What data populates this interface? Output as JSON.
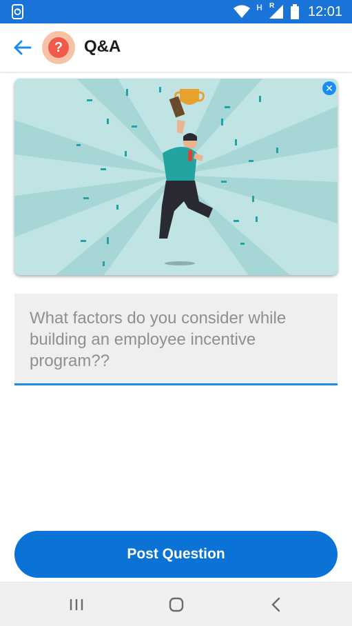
{
  "status_bar": {
    "time": "12:01",
    "network_label": "H",
    "roaming_label": "R",
    "icons": [
      "sync-phone-icon",
      "wifi-icon",
      "signal-icon",
      "battery-icon"
    ]
  },
  "app_bar": {
    "title": "Q&A",
    "avatar_glyph": "?",
    "back_icon": "arrow-left-icon",
    "accent_color": "#1a8cf0"
  },
  "banner": {
    "illustration": "celebrating-man-with-trophy",
    "close_icon": "close-icon"
  },
  "question": {
    "text": "What factors do you consider while building an employee incentive program??"
  },
  "post_button": {
    "label": "Post Question",
    "color": "#0b72d6"
  },
  "nav_bar": {
    "icons": [
      "recent-apps-icon",
      "home-icon",
      "back-icon"
    ]
  }
}
